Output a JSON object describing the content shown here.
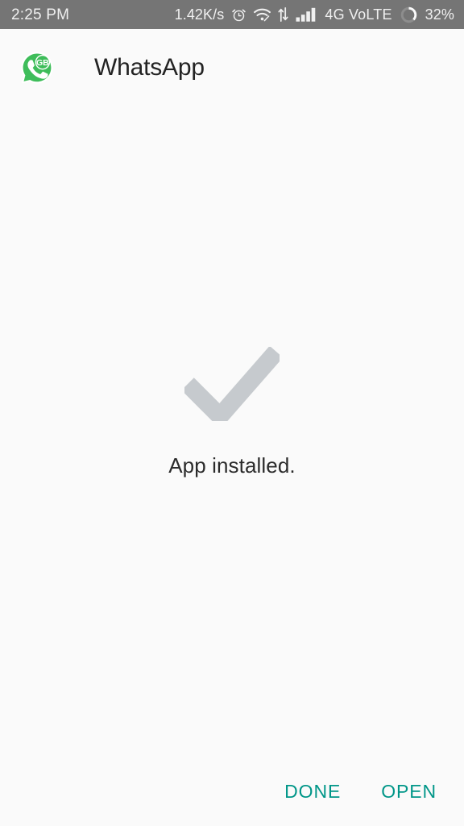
{
  "status_bar": {
    "time": "2:25 PM",
    "data_speed": "1.42K/s",
    "network_type": "4G VoLTE",
    "battery_percent": "32%",
    "battery_level": 32,
    "signal_bars": 4,
    "icons": [
      "alarm-icon",
      "wifi-icon",
      "data-transfer-icon",
      "cellular-signal-icon",
      "battery-circle-icon"
    ],
    "background_color": "#757575",
    "text_color": "#f0f0f0"
  },
  "header": {
    "app_name": "WhatsApp",
    "icon_name": "whatsapp-gb-logo",
    "icon_badge_text": "GB",
    "icon_color": "#3ebd5a"
  },
  "main": {
    "status_message": "App installed.",
    "check_icon_name": "checkmark-icon",
    "check_icon_color": "#c6cace"
  },
  "actions": {
    "done_label": "DONE",
    "open_label": "OPEN",
    "accent_color": "#009688"
  },
  "page": {
    "background_color": "#fafafa"
  }
}
